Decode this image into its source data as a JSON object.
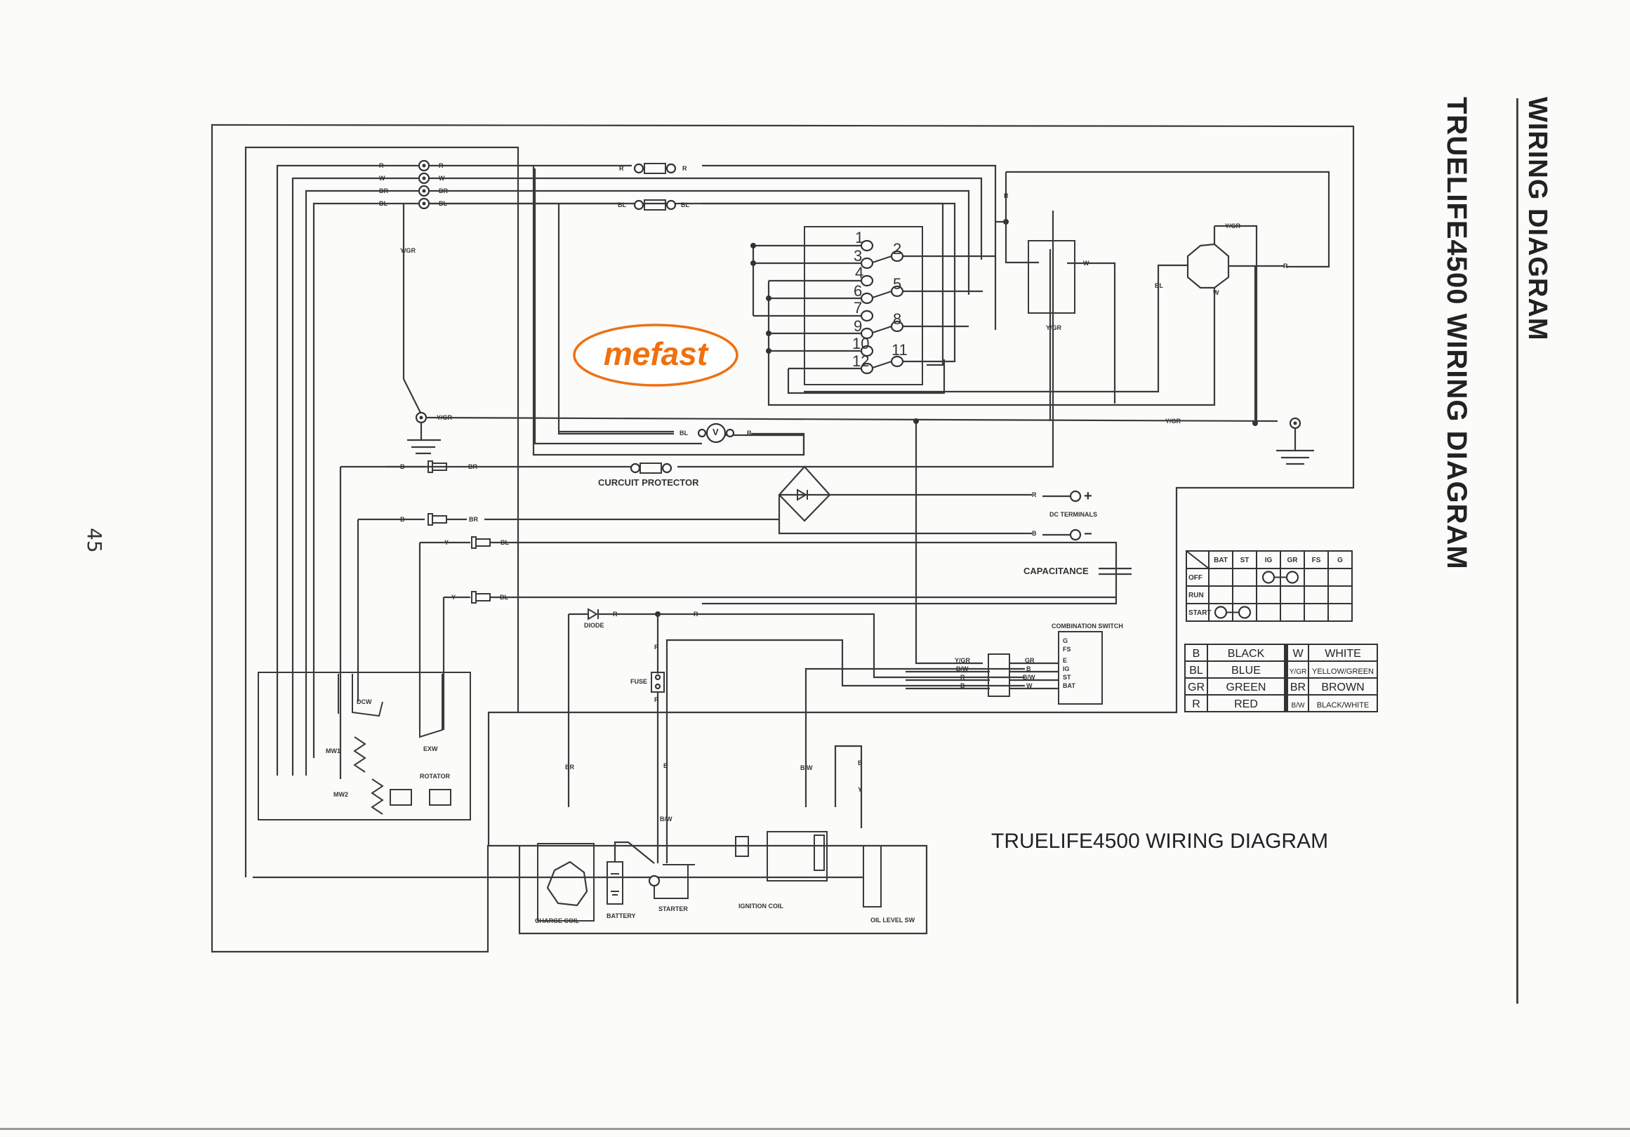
{
  "page": {
    "page_number": "45",
    "side_title": "WIRING DIAGRAM",
    "side_subtitle": "TRUELIFE4500 WIRING DIAGRAM",
    "diagram_title": "TRUELIFE4500 WIRING DIAGRAM",
    "watermark_logo": "mefast",
    "logo_color": "#f07010"
  },
  "components": {
    "circuit_protector": "CURCUIT PROTECTOR",
    "dc_terminals": "DC TERMINALS",
    "dc_plus": "+",
    "dc_minus": "−",
    "capacitance": "CAPACITANCE",
    "diode": "DIODE",
    "fuse": "FUSE",
    "combination_switch": "COMBINATION SWITCH",
    "charge_coil": "CHARGE COIL",
    "battery": "BATTERY",
    "starter": "STARTER",
    "ignition_coil": "IGNITION COIL",
    "oil_level_sw": "OIL LEVEL SW",
    "rotator": "ROTATOR",
    "voltmeter": "V",
    "dcw": "DCW",
    "exw": "EXW",
    "mw1": "MW1",
    "mw2": "MW2",
    "combo_switch_pins": [
      "G",
      "FS",
      "E",
      "IG",
      "ST",
      "BAT"
    ]
  },
  "outlet_terminals": [
    "1",
    "2",
    "3",
    "4",
    "5",
    "6",
    "7",
    "8",
    "9",
    "10",
    "11",
    "12"
  ],
  "wire_labels": {
    "R": "R",
    "W": "W",
    "BR": "BR",
    "BL": "BL",
    "B": "B",
    "Y": "Y",
    "YGR": "Y/GR",
    "BW": "B/W",
    "GR": "GR"
  },
  "switch_table": {
    "columns": [
      "BAT",
      "ST",
      "IG",
      "GR",
      "FS",
      "G"
    ],
    "rows": [
      {
        "label": "OFF",
        "connected": [
          "IG",
          "GR"
        ]
      },
      {
        "label": "RUN",
        "connected": []
      },
      {
        "label": "START",
        "connected": [
          "BAT",
          "ST"
        ]
      }
    ]
  },
  "color_legend": [
    {
      "code": "B",
      "name": "BLACK",
      "code2": "W",
      "name2": "WHITE"
    },
    {
      "code": "BL",
      "name": "BLUE",
      "code2": "Y/GR",
      "name2": "YELLOW/GREEN"
    },
    {
      "code": "GR",
      "name": "GREEN",
      "code2": "BR",
      "name2": "BROWN"
    },
    {
      "code": "R",
      "name": "RED",
      "code2": "B/W",
      "name2": "BLACK/WHITE"
    }
  ]
}
